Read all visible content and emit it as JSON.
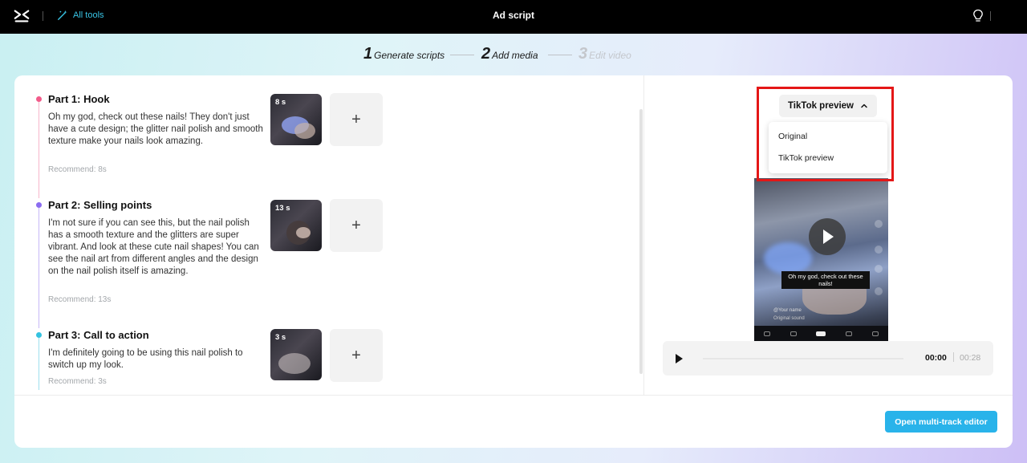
{
  "topbar": {
    "all_tools": "All tools",
    "title": "Ad script"
  },
  "steps": [
    {
      "num": "1",
      "label": "Generate scripts",
      "state": "done"
    },
    {
      "num": "2",
      "label": "Add media",
      "state": "current"
    },
    {
      "num": "3",
      "label": "Edit video",
      "state": "disabled"
    }
  ],
  "parts": [
    {
      "title": "Part 1: Hook",
      "text": "Oh my god, check out these nails! They don't just have a cute design; the glitter nail polish and smooth texture make your nails look amazing.",
      "recommend": "Recommend: 8s",
      "duration": "8 s",
      "color": "#f25b8a"
    },
    {
      "title": "Part 2: Selling points",
      "text": "I'm not sure if you can see this, but the nail polish has a smooth texture and the glitters are super vibrant. And look at these cute nail shapes! You can see the nail art from different angles and the design on the nail polish itself is amazing.",
      "recommend": "Recommend: 13s",
      "duration": "13 s",
      "color": "#8b6cf0"
    },
    {
      "title": "Part 3: Call to action",
      "text": "I'm definitely going to be using this nail polish to switch up my look.",
      "recommend": "Recommend: 3s",
      "duration": "3 s",
      "color": "#34c2e0"
    }
  ],
  "add_label": "+",
  "preview": {
    "dropdown_selected": "TikTok preview",
    "options": [
      "Original",
      "TikTok preview"
    ],
    "caption": "Oh my god, check out these nails!",
    "username": "@Your name",
    "sound": "Original sound"
  },
  "player": {
    "current_time": "00:00",
    "total_time": "00:28"
  },
  "open_editor_label": "Open multi-track editor",
  "colors": {
    "accent": "#29b3ea",
    "highlight": "#e41717"
  }
}
